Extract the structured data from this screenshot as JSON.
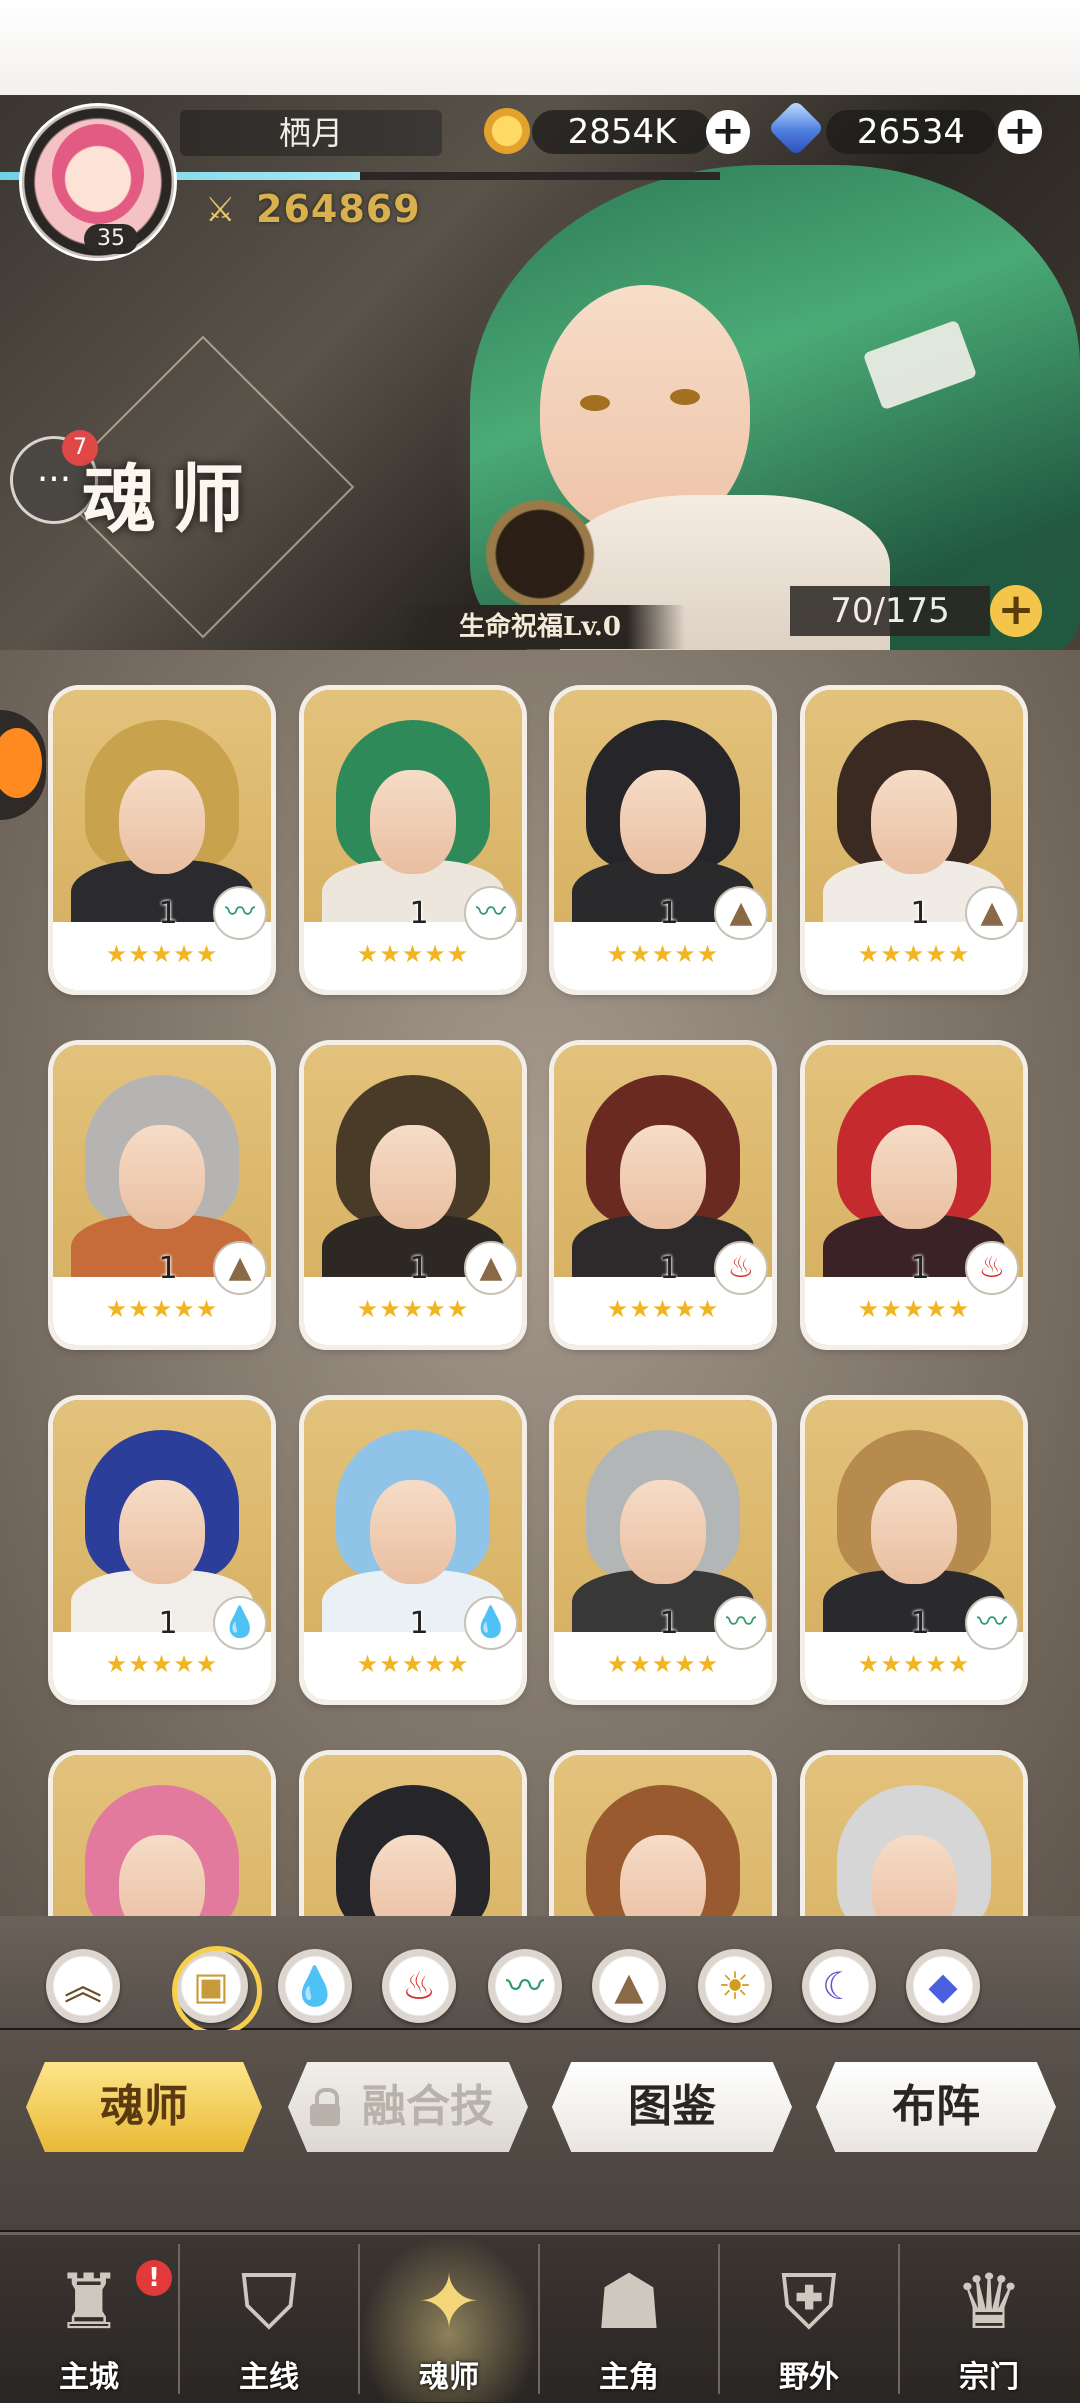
{
  "player": {
    "name": "栖月",
    "level": "35",
    "power": "264869",
    "exp_fraction": 0.5
  },
  "currency": {
    "gold": "2854K",
    "diamond": "26534",
    "plus": "+"
  },
  "chat": {
    "badge_count": "7",
    "icon": "speech-bubble-icon"
  },
  "page": {
    "title": "魂师"
  },
  "blessing": {
    "label": "生命祝福Lv.0"
  },
  "capacity": {
    "value": "70/175",
    "plus": "+"
  },
  "colors": {
    "gold_accent": "#f3c64b",
    "alert_red": "#e23a3a",
    "water": "#2a7fd0",
    "fire": "#d9342b",
    "wind": "#2d9a6a",
    "earth": "#8a6a46"
  },
  "roster": [
    {
      "level": "1",
      "element": "wind",
      "stars": "★★★★★",
      "hair": "#c9a24e",
      "body": "#2b2a2e"
    },
    {
      "level": "1",
      "element": "wind",
      "stars": "★★★★★",
      "hair": "#2f8a5a",
      "body": "#ece6dc"
    },
    {
      "level": "1",
      "element": "earth",
      "stars": "★★★★★",
      "hair": "#26262a",
      "body": "#2a2a2c"
    },
    {
      "level": "1",
      "element": "earth",
      "stars": "★★★★★",
      "hair": "#3a2a22",
      "body": "#f0ece5"
    },
    {
      "level": "1",
      "element": "earth",
      "stars": "★★★★★",
      "hair": "#b6b4b2",
      "body": "#c56c3a"
    },
    {
      "level": "1",
      "element": "earth",
      "stars": "★★★★★",
      "hair": "#4a3a28",
      "body": "#2d2823"
    },
    {
      "level": "1",
      "element": "fire",
      "stars": "★★★★★",
      "hair": "#6a2a22",
      "body": "#2e2a2c"
    },
    {
      "level": "1",
      "element": "fire",
      "stars": "★★★★★",
      "hair": "#c52a2e",
      "body": "#3a2226"
    },
    {
      "level": "1",
      "element": "water",
      "stars": "★★★★★",
      "hair": "#2b3f9a",
      "body": "#f1eee9"
    },
    {
      "level": "1",
      "element": "water",
      "stars": "★★★★★",
      "hair": "#8fc3e8",
      "body": "#e9f1f7"
    },
    {
      "level": "1",
      "element": "wind",
      "stars": "★★★★★",
      "hair": "#b3b6b6",
      "body": "#383838"
    },
    {
      "level": "1",
      "element": "wind",
      "stars": "★★★★★",
      "hair": "#b78a4e",
      "body": "#2a2a2e"
    },
    {
      "level": "",
      "element": "",
      "stars": "",
      "hair": "#e27a9e",
      "body": "#e7a9b8"
    },
    {
      "level": "",
      "element": "",
      "stars": "",
      "hair": "#26262a",
      "body": "#2a2a2c"
    },
    {
      "level": "",
      "element": "",
      "stars": "",
      "hair": "#9a5a30",
      "body": "#e9d7c8"
    },
    {
      "level": "",
      "element": "",
      "stars": "",
      "hair": "#d6d6d6",
      "body": "#d8d6d3"
    }
  ],
  "element_icons": {
    "wind": "〰",
    "earth": "▲",
    "fire": "♨",
    "water": "💧"
  },
  "filters": [
    {
      "name": "collapse-chevron-icon",
      "glyph": "︽"
    },
    {
      "name": "all-box-icon",
      "glyph": "▣"
    },
    {
      "name": "water-filter-icon",
      "glyph": "💧"
    },
    {
      "name": "fire-filter-icon",
      "glyph": "♨"
    },
    {
      "name": "wind-filter-icon",
      "glyph": "〰"
    },
    {
      "name": "earth-filter-icon",
      "glyph": "▲"
    },
    {
      "name": "light-filter-icon",
      "glyph": "☀"
    },
    {
      "name": "dark-filter-icon",
      "glyph": "☾"
    },
    {
      "name": "special-filter-icon",
      "glyph": "◆"
    }
  ],
  "sub_tabs": {
    "heroes": "魂师",
    "fusion": "融合技",
    "codex": "图鉴",
    "formation": "布阵"
  },
  "bottom_nav": [
    {
      "label": "主城",
      "icon": "castle-icon",
      "glyph": "♜"
    },
    {
      "label": "主线",
      "icon": "mainline-crest-icon",
      "glyph": "⛉"
    },
    {
      "label": "魂师",
      "icon": "soul-master-icon",
      "glyph": "✦"
    },
    {
      "label": "主角",
      "icon": "hooded-hero-icon",
      "glyph": "☗"
    },
    {
      "label": "野外",
      "icon": "field-shield-icon",
      "glyph": "⛨"
    },
    {
      "label": "宗门",
      "icon": "sect-emblem-icon",
      "glyph": "♛"
    }
  ],
  "nav_alert": "!"
}
